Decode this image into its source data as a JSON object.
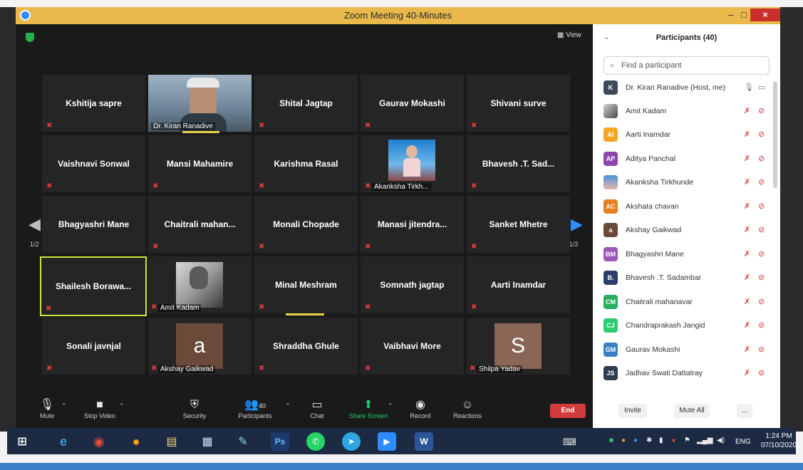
{
  "window": {
    "title": "Zoom Meeting 40-Minutes",
    "minimize": "–",
    "maximize": "□",
    "close": "×"
  },
  "view_button": "View",
  "tiles": [
    {
      "name": "Kshitija sapre"
    },
    {
      "name": "",
      "label": "Dr. Kiran Ranadive",
      "video": true
    },
    {
      "name": "Shital Jagtap"
    },
    {
      "name": "Gaurav Mokashi"
    },
    {
      "name": "Shivani surve"
    },
    {
      "name": "Vaishnavi Sonwal"
    },
    {
      "name": "Mansi Mahamire"
    },
    {
      "name": "Karishma Rasal"
    },
    {
      "name": "",
      "label": "Akanksha Tirkh..."
    },
    {
      "name": "Bhavesh .T. Sad..."
    },
    {
      "name": "Bhagyashri Mane"
    },
    {
      "name": "Chaitrali  mahan..."
    },
    {
      "name": "Monali Chopade"
    },
    {
      "name": "Manasi  jitendra..."
    },
    {
      "name": "Sanket Mhetre"
    },
    {
      "name": "Shailesh  Borawa..."
    },
    {
      "name": "",
      "label": "Amit Kadam"
    },
    {
      "name": "Minal Meshram"
    },
    {
      "name": "Somnath jagtap"
    },
    {
      "name": "Aarti Inamdar"
    },
    {
      "name": "Sonali javnjal"
    },
    {
      "name": "",
      "label": "Akshay Gaikwad",
      "letter": "a"
    },
    {
      "name": "Shraddha Ghule"
    },
    {
      "name": "Vaibhavi More"
    },
    {
      "name": "",
      "label": "Shilpa Yadav",
      "letter": "S"
    }
  ],
  "pager": {
    "left": "1/2",
    "right": "1/2"
  },
  "controls": {
    "mute": "Mute",
    "stop_video": "Stop Video",
    "security": "Security",
    "participants": "Participants",
    "participants_count": "40",
    "chat": "Chat",
    "share_screen": "Share Screen",
    "record": "Record",
    "reactions": "Reactions",
    "end": "End"
  },
  "panel": {
    "title": "Participants (40)",
    "search_placeholder": "Find a participant",
    "participants": [
      {
        "initials": "K",
        "name": "Dr. Kiran Ranadive (Host, me)",
        "color": "#3e4a5c",
        "host": true
      },
      {
        "initials": "",
        "name": "Amit Kadam",
        "color": "#7a7a7a",
        "photo": true
      },
      {
        "initials": "AI",
        "name": "Aarti Inamdar",
        "color": "#f5a623"
      },
      {
        "initials": "AP",
        "name": "Aditya Panchal",
        "color": "#8e44ad"
      },
      {
        "initials": "",
        "name": "Akanksha Tirkhunde",
        "color": "#c07a5a",
        "photo": true
      },
      {
        "initials": "AC",
        "name": "Akshata chavan",
        "color": "#e67e22"
      },
      {
        "initials": "a",
        "name": "Akshay Gaikwad",
        "color": "#6b4a3a"
      },
      {
        "initials": "BM",
        "name": "Bhagyashri Mane",
        "color": "#9b59b6"
      },
      {
        "initials": "B.",
        "name": "Bhavesh .T. Sadambar",
        "color": "#2c3e6b"
      },
      {
        "initials": "CM",
        "name": "Chaitrali mahanavar",
        "color": "#27ae60"
      },
      {
        "initials": "CJ",
        "name": "Chandraprakash Jangid",
        "color": "#2ecc71"
      },
      {
        "initials": "GM",
        "name": "Gaurav Mokashi",
        "color": "#3b7fc6"
      },
      {
        "initials": "JS",
        "name": "Jadhav Swati Dattatray",
        "color": "#2c3e50"
      }
    ],
    "invite": "Invite",
    "mute_all": "Mute All",
    "more": "..."
  },
  "taskbar": {
    "lang": "ENG",
    "time": "1:24 PM",
    "date": "07/10/2020",
    "apps": [
      "e",
      "◉",
      "●",
      "▤",
      "▦",
      "✎",
      "Ps",
      "✆",
      "➤",
      "▶",
      "W"
    ]
  }
}
